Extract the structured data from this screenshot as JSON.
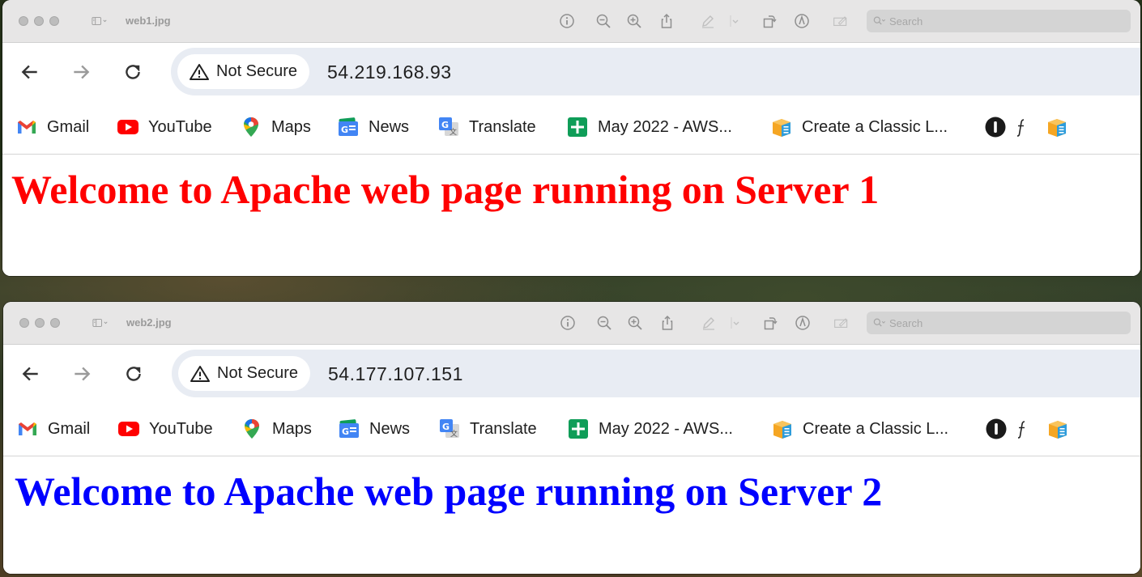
{
  "colors": {
    "server1_heading": "#ff0000",
    "server2_heading": "#0000ff"
  },
  "windows": [
    {
      "title": "web1.jpg",
      "search_placeholder": "Search",
      "security_label": "Not Secure",
      "url": "54.219.168.93",
      "bookmarks": {
        "gmail": "Gmail",
        "youtube": "YouTube",
        "maps": "Maps",
        "news": "News",
        "translate": "Translate",
        "sheet": "May 2022 - AWS...",
        "classic": "Create a Classic L..."
      },
      "heading": "Welcome to Apache web page running on Server 1"
    },
    {
      "title": "web2.jpg",
      "search_placeholder": "Search",
      "security_label": "Not Secure",
      "url": "54.177.107.151",
      "bookmarks": {
        "gmail": "Gmail",
        "youtube": "YouTube",
        "maps": "Maps",
        "news": "News",
        "translate": "Translate",
        "sheet": "May 2022 - AWS...",
        "classic": "Create a Classic L..."
      },
      "heading": "Welcome to Apache web page running on Server 2"
    }
  ]
}
